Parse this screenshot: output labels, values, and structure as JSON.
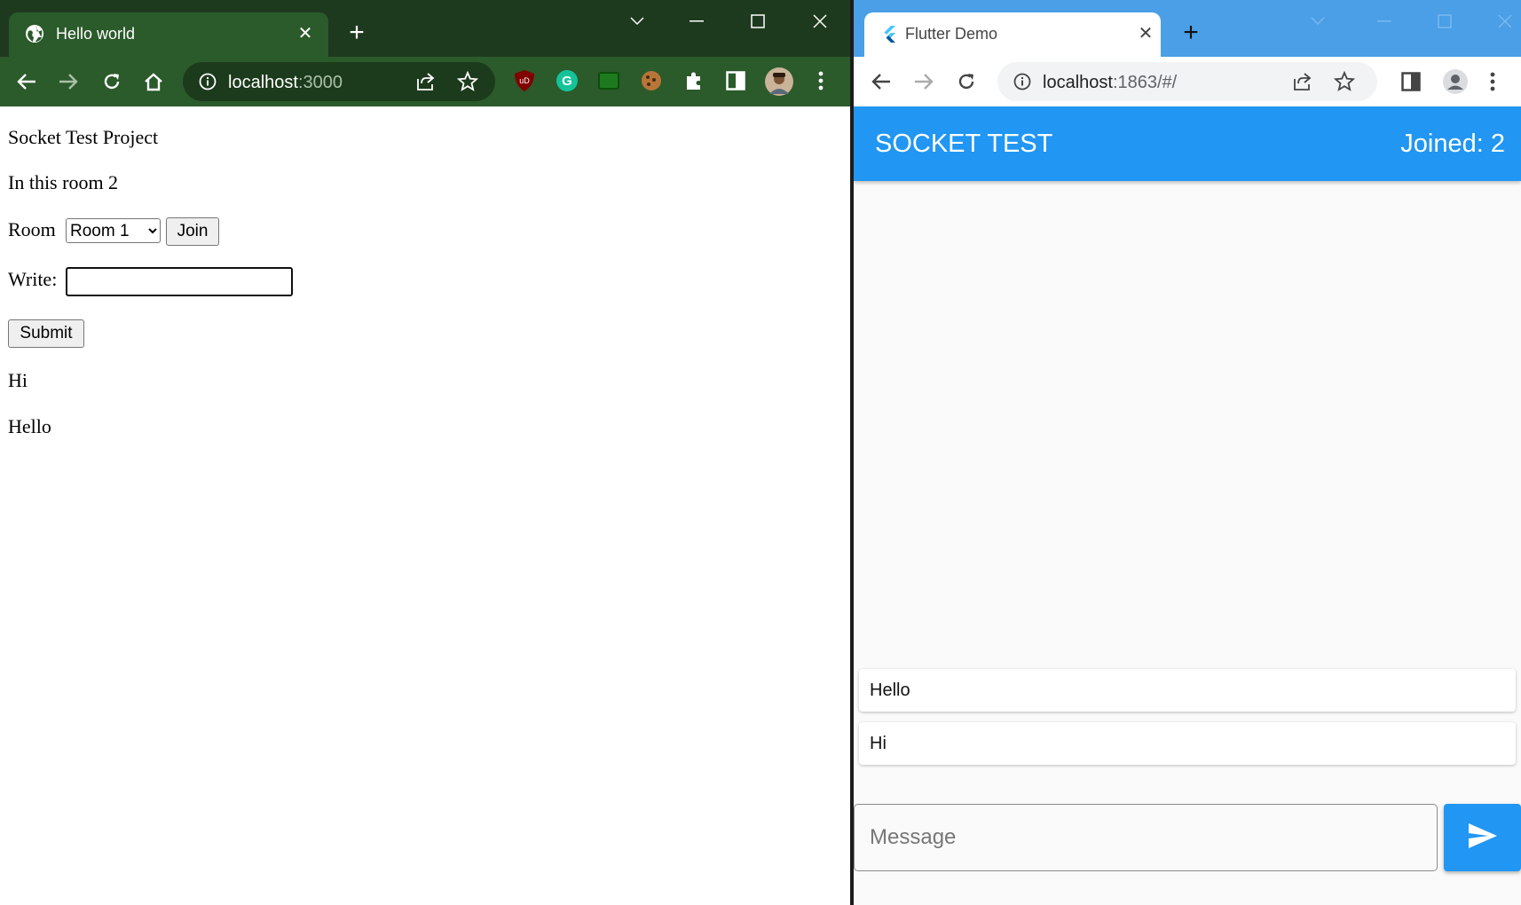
{
  "left_window": {
    "tab": {
      "title": "Hello world",
      "close": "✕"
    },
    "new_tab": "+",
    "address": {
      "host": "localhost",
      "port": ":3000"
    },
    "colors": {
      "frame": "#1e3a1e",
      "active_tab": "#2b5a2b",
      "toolbar": "#2b5a2b",
      "omnibox": "#1c3a1c"
    },
    "page": {
      "heading": "Socket Test Project",
      "room_count_text": "In this room 2",
      "room_label": "Room",
      "room_selected": "Room 1",
      "join_label": "Join",
      "write_label": "Write:",
      "write_value": "",
      "submit_label": "Submit",
      "messages": [
        "Hi",
        "Hello"
      ]
    }
  },
  "right_window": {
    "tab": {
      "title": "Flutter Demo",
      "close": "✕"
    },
    "new_tab": "+",
    "address": {
      "host": "localhost",
      "rest": ":1863/#/"
    },
    "colors": {
      "frame": "#4a9fe6",
      "tab": "#ffffff",
      "toolbar": "#ffffff",
      "appbar": "#2196f3"
    },
    "app": {
      "title": "SOCKET TEST",
      "joined": "Joined: 2",
      "messages": [
        "Hello",
        "Hi"
      ],
      "input_placeholder": "Message",
      "input_value": ""
    }
  }
}
